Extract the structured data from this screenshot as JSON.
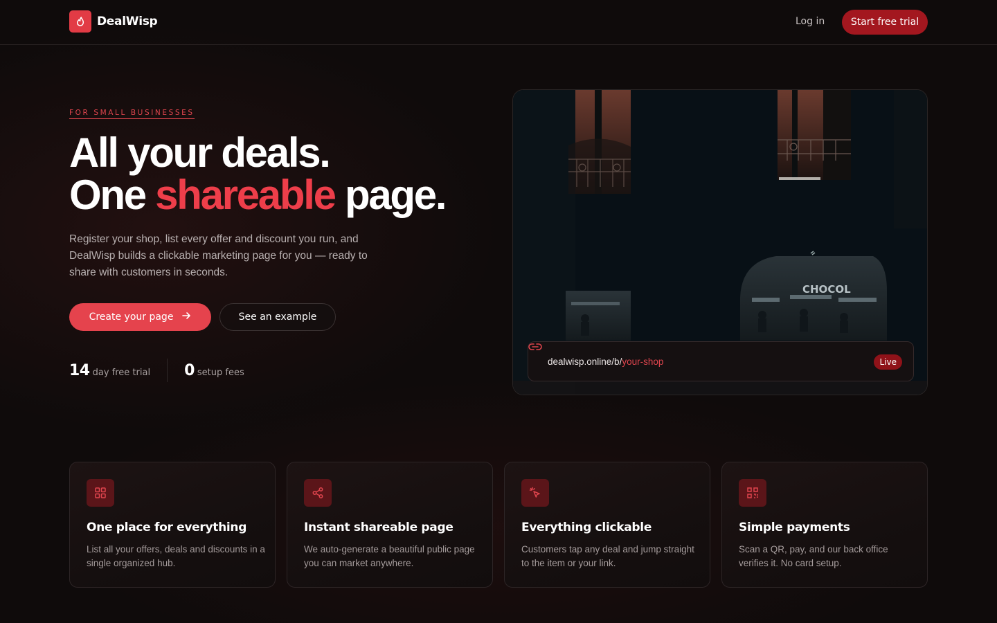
{
  "brand": {
    "name": "DealWisp",
    "logo_icon": "flame-icon",
    "accent": "#e5434d"
  },
  "nav": {
    "login_label": "Log in",
    "trial_label": "Start free trial"
  },
  "hero": {
    "eyebrow": "FOR SMALL BUSINESSES",
    "headline_line1": "All your deals.",
    "headline_line2_prefix": "One ",
    "headline_line2_accent": "shareable",
    "headline_line2_suffix": " page.",
    "lead": "Register your shop, list every offer and discount you run, and DealWisp builds a clickable marketing page for you — ready to share with customers in seconds.",
    "cta_primary": "Create your page",
    "cta_primary_icon": "arrow-right-icon",
    "cta_secondary": "See an example"
  },
  "stats": [
    {
      "number": "14",
      "label": "day free trial"
    },
    {
      "number": "0",
      "label": "setup fees"
    }
  ],
  "preview": {
    "url_icon": "link-icon",
    "url_base": "dealwisp.online/b/",
    "url_slug": "your-shop",
    "badge": "Live",
    "sign_text": "CHOCOL"
  },
  "features": [
    {
      "icon": "grid-icon",
      "title": "One place for everything",
      "desc": "List all your offers, deals and discounts in a single organized hub."
    },
    {
      "icon": "share-icon",
      "title": "Instant shareable page",
      "desc": "We auto-generate a beautiful public page you can market anywhere."
    },
    {
      "icon": "cursor-click-icon",
      "title": "Everything clickable",
      "desc": "Customers tap any deal and jump straight to the item or your link."
    },
    {
      "icon": "qr-code-icon",
      "title": "Simple payments",
      "desc": "Scan a QR, pay, and our back office verifies it. No card setup."
    }
  ]
}
